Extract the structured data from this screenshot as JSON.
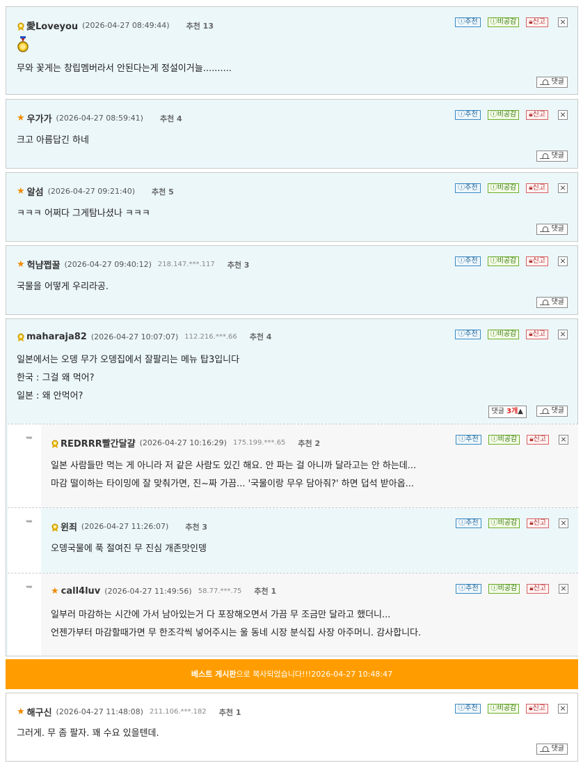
{
  "buttons": {
    "recommend": "ⓘ추천",
    "disagree": "ⓘ비공감",
    "report": "신고",
    "reply": "댓글"
  },
  "comments": [
    {
      "badge": "rank-icon",
      "nick": "愛Loveyou",
      "date": "(2026-04-27 08:49:44)",
      "ip": "",
      "rec": "추천 13",
      "lines": [
        "무와 꽃게는 창립멤버라서 안된다는게 정설이거늘.........."
      ]
    },
    {
      "badge": "star-icon",
      "nick": "우가가",
      "date": "(2026-04-27 08:59:41)",
      "ip": "",
      "rec": "추천 4",
      "lines": [
        "크고 아름답긴 하네"
      ]
    },
    {
      "badge": "star-icon",
      "nick": "알섬",
      "date": "(2026-04-27 09:21:40)",
      "ip": "",
      "rec": "추천 5",
      "lines": [
        "ㅋㅋㅋ 어쩌다 그게탐나셨나 ㅋㅋㅋ"
      ]
    },
    {
      "badge": "star-icon",
      "nick": "헉냠쩝꿀",
      "date": "(2026-04-27 09:40:12)",
      "ip": "218.147.***.117",
      "rec": "추천 3",
      "lines": [
        "국물을 어떻게 우리라공."
      ]
    },
    {
      "badge": "rank-icon",
      "nick": "maharaja82",
      "date": "(2026-04-27 10:07:07)",
      "ip": "112.216.***.66",
      "rec": "추천 4",
      "lines": [
        "일본에서는 오뎅 무가 오뎅집에서 잘팔리는 메뉴 탑3입니다",
        "한국 : 그걸 왜 먹어?",
        "일본 : 왜 안먹어?"
      ],
      "reply_count_prefix": "댓글 ",
      "reply_count": "3개",
      "reply_count_arrow": "▲"
    }
  ],
  "replies": [
    {
      "badge": "rank-icon",
      "nick": "REDRRR빨간달걀",
      "date": "(2026-04-27 10:16:29)",
      "ip": "175.199.***.65",
      "rec": "추천 2",
      "lines": [
        "일본 사람들만 먹는 게 아니라 저 같은 사람도 있긴 해요. 안 파는 걸 아니까 달라고는 안 하는데...",
        "마감 떨이하는 타이밍에 잘 맞춰가면, 진~짜 가끔... '국물이랑 무우 담아줘?' 하면 덥석 받아옵..."
      ]
    },
    {
      "badge": "rank-icon",
      "nick": "윈죄",
      "date": "(2026-04-27 11:26:07)",
      "ip": "",
      "rec": "추천 3",
      "lines": [
        "오뎅국물에 푹 절여진 무 진심 개존맛인뎅"
      ]
    },
    {
      "badge": "star-icon",
      "nick": "call4luv",
      "date": "(2026-04-27 11:49:56)",
      "ip": "58.77.***.75",
      "rec": "추천 1",
      "lines": [
        "일부러 마감하는 시간에 가서 남아있는거 다 포장해오면서 가끔 무 조금만 달라고 했더니...",
        "언젠가부터 마감할때가면 무 한조각씩 넣어주시는 울 동네 시장 분식집 사장 아주머니. 감사합니다."
      ]
    }
  ],
  "banner": {
    "board": "베스트 게시판",
    "message": "으로 복사되었습니다!!!2026-04-27 10:48:47"
  },
  "last_comment": {
    "badge": "star-icon",
    "nick": "해구신",
    "date": "(2026-04-27 11:48:08)",
    "ip": "211.106.***.182",
    "rec": "추천 1",
    "lines": [
      "그러게. 무 좀 팔자. 꽤 수요 있을텐데."
    ]
  },
  "colors": {
    "accent_orange": "#ff9d00",
    "comment_bg_blue": "#ecf7fa",
    "reply_bg_gray": "#f7f7f7",
    "star": "#f08a00"
  }
}
